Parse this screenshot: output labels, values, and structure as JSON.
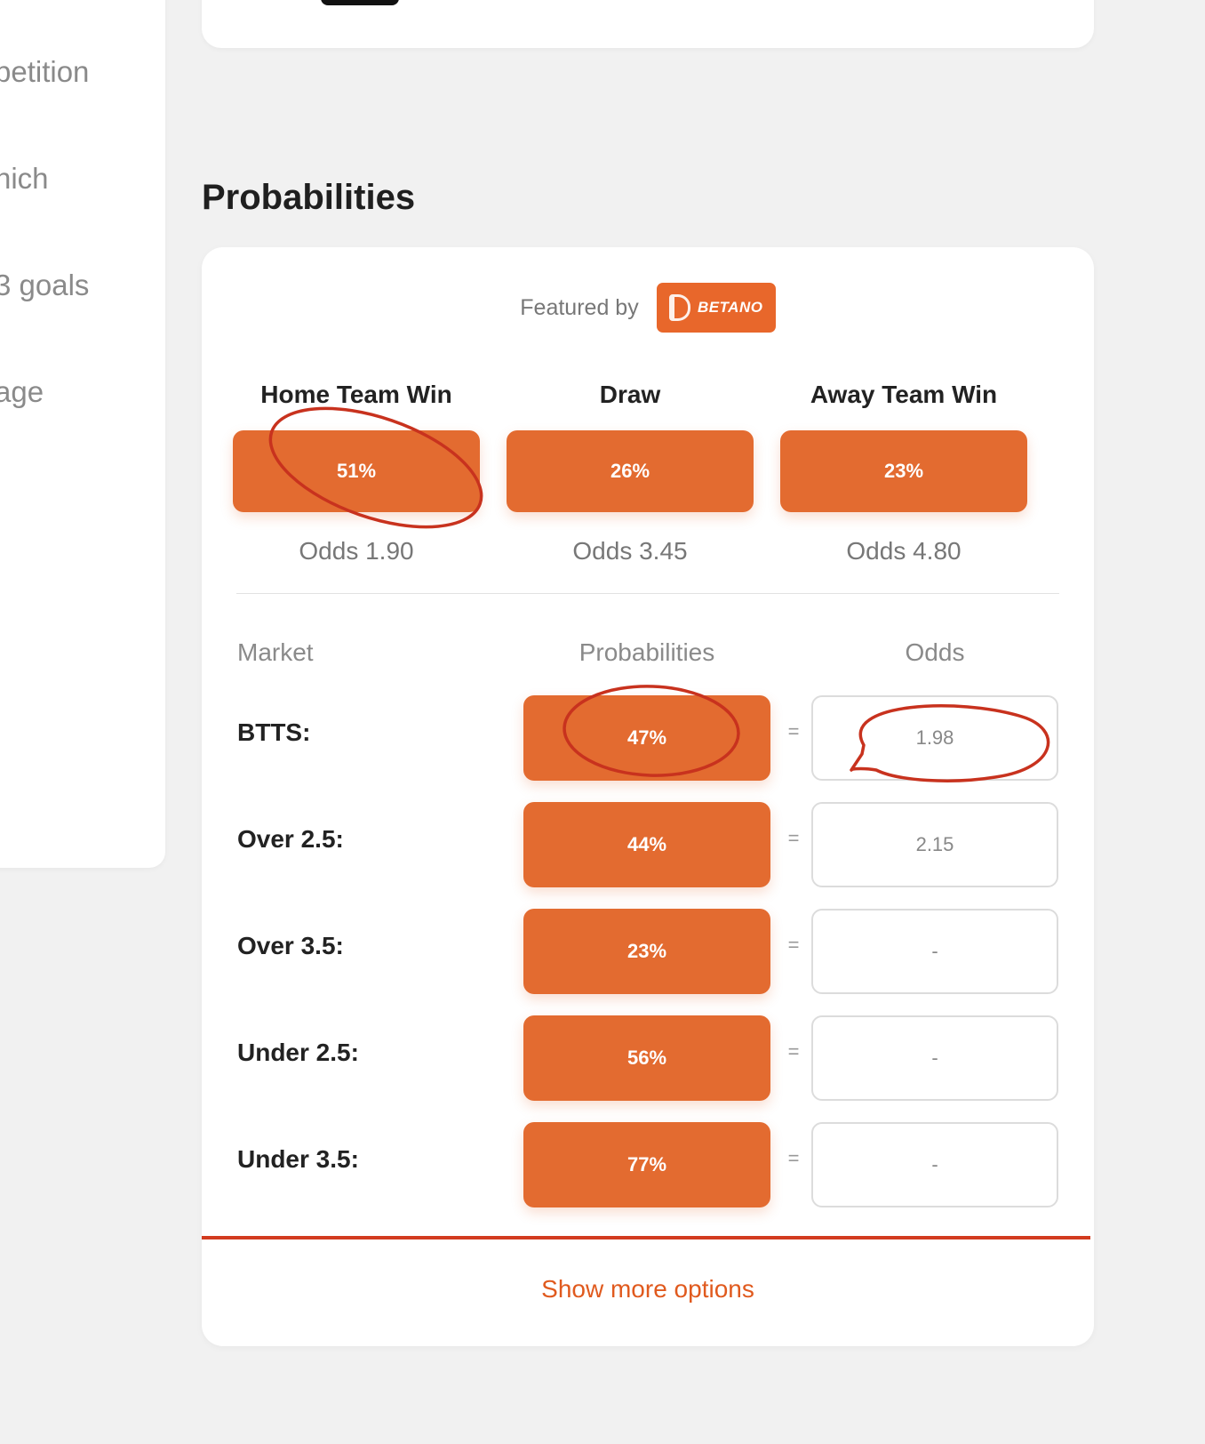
{
  "sidebar": {
    "items": [
      "petition",
      "hich",
      "3 goals",
      "age"
    ]
  },
  "section": {
    "title": "Probabilities"
  },
  "featured": {
    "label": "Featured by",
    "brand": "BETANO"
  },
  "outcomes": [
    {
      "label": "Home Team Win",
      "probability": "51%",
      "odds": "Odds 1.90"
    },
    {
      "label": "Draw",
      "probability": "26%",
      "odds": "Odds 3.45"
    },
    {
      "label": "Away Team Win",
      "probability": "23%",
      "odds": "Odds 4.80"
    }
  ],
  "table": {
    "headers": {
      "market": "Market",
      "probabilities": "Probabilities",
      "odds": "Odds"
    },
    "equals": "=",
    "rows": [
      {
        "market": "BTTS:",
        "probability": "47%",
        "odds": "1.98"
      },
      {
        "market": "Over 2.5:",
        "probability": "44%",
        "odds": "2.15"
      },
      {
        "market": "Over 3.5:",
        "probability": "23%",
        "odds": "-"
      },
      {
        "market": "Under 2.5:",
        "probability": "56%",
        "odds": "-"
      },
      {
        "market": "Under 3.5:",
        "probability": "77%",
        "odds": "-"
      }
    ]
  },
  "footer": {
    "show_more": "Show more options"
  },
  "colors": {
    "accent": "#e36b30",
    "rule": "#d23b1f",
    "annotation": "#c8321e",
    "background": "#f1f1f1"
  }
}
